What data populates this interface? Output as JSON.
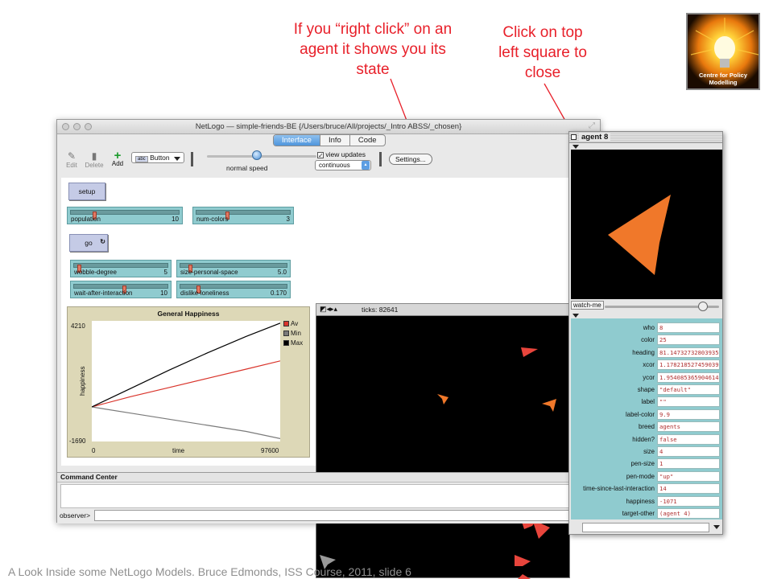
{
  "callouts": {
    "right_click": "If you “right click” on an agent it shows you its state",
    "close": "Click on top left square to close"
  },
  "logo": {
    "text": "Centre for Policy Modelling"
  },
  "window": {
    "title": "NetLogo — simple-friends-BE {/Users/bruce/All/projects/_Intro ABSS/_chosen}",
    "tabs": [
      {
        "label": "Interface",
        "active": true
      },
      {
        "label": "Info",
        "active": false
      },
      {
        "label": "Code",
        "active": false
      }
    ]
  },
  "toolbar": {
    "edit_label": "Edit",
    "delete_label": "Delete",
    "add_label": "Add",
    "widget_select": "Button",
    "widget_select_icon": "abc",
    "speed_label": "normal speed",
    "view_updates_label": "view updates",
    "view_updates_checked": true,
    "update_mode": "continuous",
    "settings_label": "Settings..."
  },
  "buttons": {
    "setup": "setup",
    "go": "go"
  },
  "sliders": {
    "population": {
      "label": "population",
      "value": "10",
      "fraction": 0.02
    },
    "num_colors": {
      "label": "num-colors",
      "value": "3",
      "fraction": 0.3
    },
    "wobble_degree": {
      "label": "wobble-degree",
      "value": "5",
      "fraction": 0.02
    },
    "size_personal_space": {
      "label": "size-personal-space",
      "value": "5.0",
      "fraction": 0.1
    },
    "wait_after_interaction": {
      "label": "wait-after-interaction",
      "value": "10",
      "fraction": 0.5
    },
    "dislike_loneliness": {
      "label": "dislike-loneliness",
      "value": "0.170",
      "fraction": 0.17
    }
  },
  "chart_data": {
    "type": "line",
    "title": "General Happiness",
    "xlabel": "time",
    "ylabel": "happiness",
    "xlim": [
      0,
      97600
    ],
    "ylim": [
      -1690,
      4210
    ],
    "x_tick_labels": [
      "0",
      "97600"
    ],
    "y_tick_labels": [
      "4210",
      "-1690"
    ],
    "legend_position": "right",
    "series": [
      {
        "name": "Av",
        "color": "#d9342b",
        "x": [
          0,
          20000,
          40000,
          60000,
          80000,
          97600
        ],
        "y": [
          0,
          500,
          950,
          1400,
          1850,
          2250
        ]
      },
      {
        "name": "Min",
        "color": "#7a7a7a",
        "x": [
          0,
          20000,
          40000,
          60000,
          80000,
          97600
        ],
        "y": [
          0,
          -300,
          -600,
          -900,
          -1200,
          -1550
        ]
      },
      {
        "name": "Max",
        "color": "#000000",
        "x": [
          0,
          20000,
          40000,
          60000,
          80000,
          97600
        ],
        "y": [
          0,
          900,
          1800,
          2650,
          3450,
          4100
        ]
      }
    ]
  },
  "view": {
    "ticks": "ticks: 82641"
  },
  "command_center": {
    "title": "Command Center",
    "prompt": "observer>"
  },
  "agent_monitor": {
    "title": "agent 8",
    "watch_label": "watch-me",
    "properties": [
      {
        "label": "who",
        "value": "8"
      },
      {
        "label": "color",
        "value": "25"
      },
      {
        "label": "heading",
        "value": "81.14732732803935"
      },
      {
        "label": "xcor",
        "value": "1.178218527459039"
      },
      {
        "label": "ycor",
        "value": "1.954085365904614"
      },
      {
        "label": "shape",
        "value": "\"default\""
      },
      {
        "label": "label",
        "value": "\"\""
      },
      {
        "label": "label-color",
        "value": "9.9"
      },
      {
        "label": "breed",
        "value": "agents"
      },
      {
        "label": "hidden?",
        "value": "false"
      },
      {
        "label": "size",
        "value": "4"
      },
      {
        "label": "pen-size",
        "value": "1"
      },
      {
        "label": "pen-mode",
        "value": "\"up\""
      },
      {
        "label": "time-since-last-interaction",
        "value": "14"
      },
      {
        "label": "happiness",
        "value": "-1071"
      },
      {
        "label": "target-other",
        "value": "(agent 4)"
      }
    ]
  },
  "colors": {
    "agent_orange": "#f0782a",
    "agent_red": "#e8453c",
    "agent_grey": "#9a9a9a",
    "callout_red": "#e8202a"
  },
  "footer": "A Look Inside some NetLogo Models. Bruce Edmonds, ISS Course, 2011, slide 6"
}
